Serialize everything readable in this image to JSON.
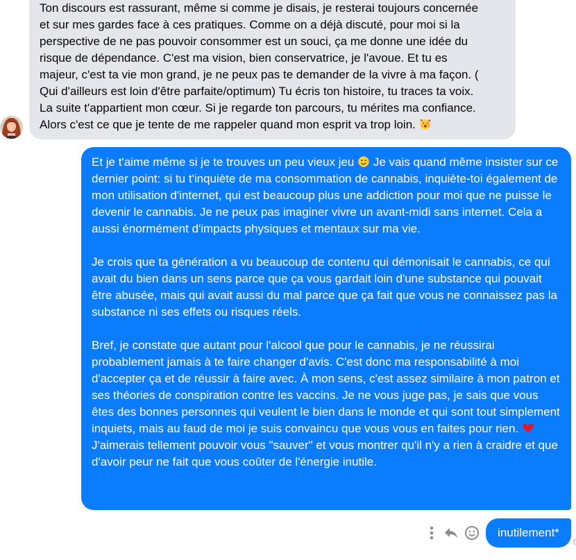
{
  "thread": {
    "incoming_message": {
      "lines": [
        "Ton discours est rassurant, même si comme je disais, je resterai toujours concernée",
        "et sur mes gardes face à ces pratiques. Comme on a déjà discuté, pour moi si la",
        "perspective de ne pas pouvoir consommer est un souci, ça me donne une idée du",
        "risque de dépendance. C'est ma vision, bien conservatrice, je l'avoue. Et tu es",
        "majeur, c'est ta vie mon grand, je ne peux pas te demander de la vivre à ma façon. (",
        "Qui d'ailleurs est loin d'être parfaite/optimum) Tu écris ton histoire, tu traces ta voix.",
        "La suite t'appartient mon cœur. Si je regarde ton parcours, tu mérites ma confiance.",
        "Alors c'est ce que je tente de me rappeler quand mon esprit va trop loin."
      ],
      "end_emoji": "smiling-face-with-hearts-icon"
    },
    "outgoing_message": {
      "p1_a": "Et je t'aime même si je te trouves un peu vieux jeu",
      "p1_emoji": "winking-face-icon",
      "p1_b": "Je vais quand même insister sur ce dernier point: si tu t'inquiète de ma consommation de cannabis, inquiète-toi également de mon utilisation d'internet, qui est beaucoup plus une addiction pour moi que ne puisse le devenir le cannabis. Je ne peux pas imaginer vivre un avant-midi sans internet. Cela a aussi énormément d'impacts physiques et mentaux sur ma vie.",
      "p2": "Je crois que ta génération a vu beaucoup de contenu qui démonisait le cannabis, ce qui avait du bien dans un sens parce que ça vous gardait loin d'une substance qui pouvait être abusée, mais qui avait aussi du mal parce que ça fait que vous ne connaissez pas la substance ni ses effets ou risques réels.",
      "p3_a": "Bref, je constate que autant pour l'alcool que pour le cannabis, je ne réussirai probablement jamais à te faire changer d'avis. C'est donc ma responsabilité à moi d'accepter ça et de réussir à faire avec. À mon sens, c'est assez similaire à mon patron et ses théories de conspiration contre les vaccins. Je ne vous juge pas, je sais que vous êtes des bonnes personnes qui veulent le bien dans le monde et qui sont tout simplement inquiets, mais au faud de moi je suis convaincu que vous vous en faites pour rien.",
      "p3_emoji": "red-heart-icon",
      "p3_b": "J'aimerais tellement pouvoir vous \"sauver\" et vous montrer qu'il n'y a rien à craidre et que d'avoir peur ne fait que vous coûter de l'énergie inutile."
    },
    "correction_message": "inutilement*",
    "hover_actions": [
      "more-options-icon",
      "reply-icon",
      "react-emoji-icon"
    ]
  },
  "colors": {
    "outgoing_bubble": "#0a7cff",
    "incoming_bubble": "#e4e6eb",
    "action_icon": "#8a8d91"
  }
}
